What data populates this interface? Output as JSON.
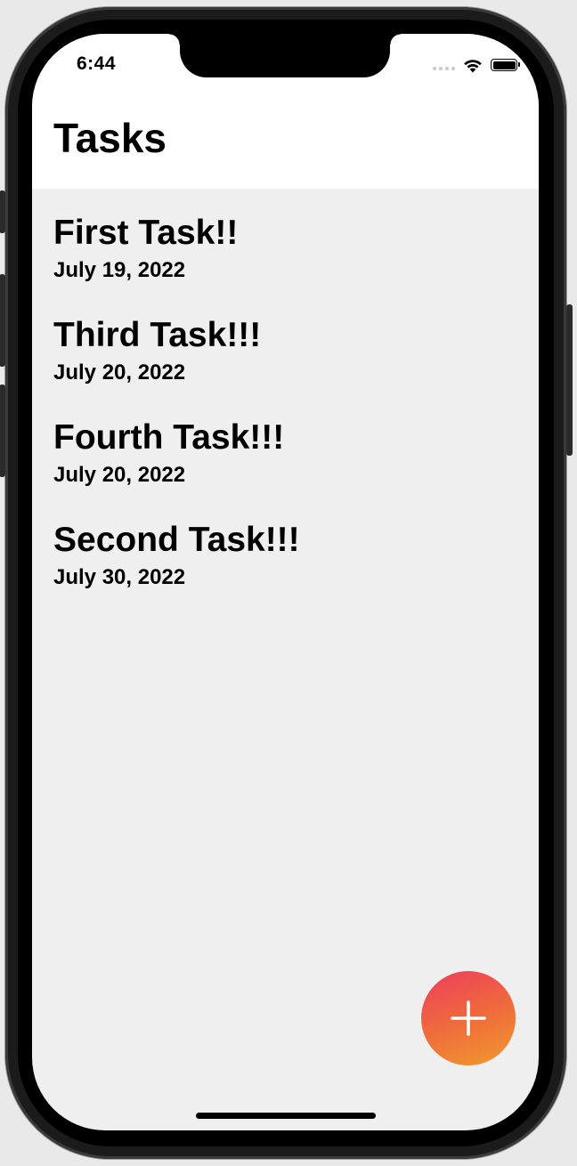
{
  "status_bar": {
    "time": "6:44",
    "icons": [
      "signal-dots-icon",
      "wifi-icon",
      "battery-icon"
    ]
  },
  "header": {
    "title": "Tasks"
  },
  "tasks": [
    {
      "title": "First Task!!",
      "date": "July 19, 2022"
    },
    {
      "title": "Third Task!!!",
      "date": "July 20, 2022"
    },
    {
      "title": "Fourth Task!!!",
      "date": "July 20, 2022"
    },
    {
      "title": "Second Task!!!",
      "date": "July 30, 2022"
    }
  ],
  "fab": {
    "icon": "plus-icon",
    "gradient_colors": [
      "#ee3d5d",
      "#ef6a3c",
      "#f19a2e"
    ]
  },
  "colors": {
    "header_background": "#ffffff",
    "list_background": "#efefef",
    "text": "#000000"
  }
}
